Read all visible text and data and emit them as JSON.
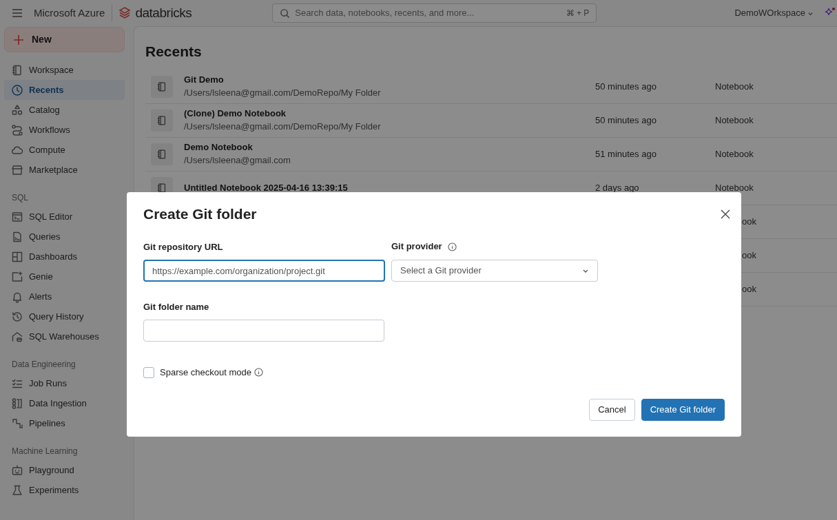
{
  "topbar": {
    "brand": "Microsoft Azure",
    "product": "databricks",
    "search": {
      "placeholder": "Search data, notebooks, recents, and more...",
      "shortcut": "⌘ + P"
    },
    "workspace": "DemoWOrkspace"
  },
  "sidebar": {
    "new_button": "New",
    "sections": [
      {
        "items": [
          {
            "label": "Workspace",
            "selected": false
          },
          {
            "label": "Recents",
            "selected": true
          },
          {
            "label": "Catalog",
            "selected": false
          },
          {
            "label": "Workflows",
            "selected": false
          },
          {
            "label": "Compute",
            "selected": false
          },
          {
            "label": "Marketplace",
            "selected": false
          }
        ]
      },
      {
        "heading": "SQL",
        "items": [
          {
            "label": "SQL Editor",
            "selected": false
          },
          {
            "label": "Queries",
            "selected": false
          },
          {
            "label": "Dashboards",
            "selected": false
          },
          {
            "label": "Genie",
            "selected": false
          },
          {
            "label": "Alerts",
            "selected": false
          },
          {
            "label": "Query History",
            "selected": false
          },
          {
            "label": "SQL Warehouses",
            "selected": false
          }
        ]
      },
      {
        "heading": "Data Engineering",
        "items": [
          {
            "label": "Job Runs",
            "selected": false
          },
          {
            "label": "Data Ingestion",
            "selected": false
          },
          {
            "label": "Pipelines",
            "selected": false
          }
        ]
      },
      {
        "heading": "Machine Learning",
        "items": [
          {
            "label": "Playground",
            "selected": false
          },
          {
            "label": "Experiments",
            "selected": false
          }
        ]
      }
    ]
  },
  "main": {
    "title": "Recents",
    "rows": [
      {
        "kind": "full",
        "title": "Git Demo",
        "path": "/Users/lsleena@gmail.com/DemoRepo/My Folder",
        "time": "50 minutes ago",
        "type": "Notebook"
      },
      {
        "kind": "full",
        "title": "(Clone) Demo Notebook",
        "path": "/Users/lsleena@gmail.com/DemoRepo/My Folder",
        "time": "50 minutes ago",
        "type": "Notebook"
      },
      {
        "kind": "full",
        "title": "Demo Notebook",
        "path": "/Users/lsleena@gmail.com",
        "time": "51 minutes ago",
        "type": "Notebook"
      },
      {
        "kind": "full",
        "title": "Untitled Notebook 2025-04-16 13:39:15",
        "time": "2 days ago",
        "type": "Notebook"
      },
      {
        "kind": "covered",
        "type": "ook"
      },
      {
        "kind": "covered",
        "type": "ook"
      },
      {
        "kind": "covered",
        "type": "ook"
      }
    ]
  },
  "dialog": {
    "title": "Create Git folder",
    "url_label": "Git repository URL",
    "url_placeholder": "https://example.com/organization/project.git",
    "provider_label": "Git provider",
    "provider_placeholder": "Select a Git provider",
    "name_label": "Git folder name",
    "sparse_label": "Sparse checkout mode",
    "sparse_checked": false,
    "buttons": [
      {
        "label": "Cancel",
        "kind": "secondary"
      },
      {
        "label": "Create Git folder",
        "kind": "primary"
      }
    ]
  }
}
